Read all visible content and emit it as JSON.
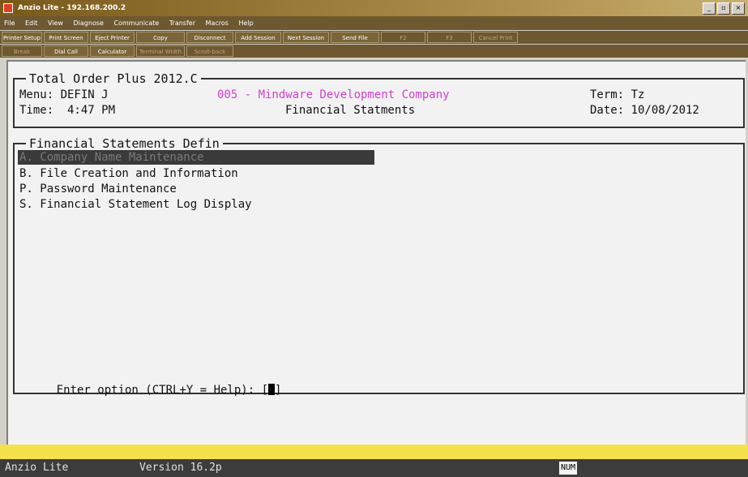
{
  "window": {
    "title": "Anzio Lite - 192.168.200.2",
    "controls": [
      "minimize-icon",
      "restore-icon",
      "close-icon"
    ]
  },
  "menubar": [
    "File",
    "Edit",
    "View",
    "Diagnose",
    "Communicate",
    "Transfer",
    "Macros",
    "Help"
  ],
  "toolbar": {
    "row1": [
      {
        "label": "Printer Setup",
        "enabled": true
      },
      {
        "label": "Print Screen",
        "enabled": true
      },
      {
        "label": "Eject Printer",
        "enabled": true
      },
      {
        "label": "Copy",
        "enabled": true
      },
      {
        "label": "Disconnect",
        "enabled": true
      },
      {
        "label": "Add Session",
        "enabled": true
      },
      {
        "label": "Next Session",
        "enabled": true
      },
      {
        "label": "Send File",
        "enabled": true
      },
      {
        "label": "F2",
        "enabled": false
      },
      {
        "label": "F3",
        "enabled": false
      },
      {
        "label": "Cancel Print",
        "enabled": false
      }
    ],
    "row2": [
      {
        "label": "Break",
        "enabled": false
      },
      {
        "label": "Dial Call",
        "enabled": true
      },
      {
        "label": "Calculator",
        "enabled": true
      },
      {
        "label": "Terminal Width",
        "enabled": false
      },
      {
        "label": "Scroll-back",
        "enabled": false
      }
    ]
  },
  "terminal": {
    "header": {
      "box_title": "Total Order Plus 2012.C",
      "menu": "Menu: DEFIN J",
      "company": "005 - Mindware Development Company",
      "term": "Term: Tz",
      "time": "Time:  4:47 PM",
      "screen_title": "Financial Statments",
      "date": "Date: 10/08/2012"
    },
    "menu_box": {
      "title": "Financial Statements Defin",
      "items": [
        "A. Company Name Maintenance",
        "B. File Creation and Information",
        "P. Password Maintenance",
        "S. Financial Statement Log Display"
      ],
      "selected_index": 0
    },
    "prompt": "Enter option (CTRL+Y = Help): [",
    "prompt_end": "]"
  },
  "status": {
    "app_name": "Anzio Lite",
    "version": "Version 16.2p",
    "num_indicator": "NUM"
  },
  "colors": {
    "accent_magenta": "#d040d0",
    "status_yellow": "#f4e24a",
    "highlight_bar": "#3a3a3a"
  }
}
